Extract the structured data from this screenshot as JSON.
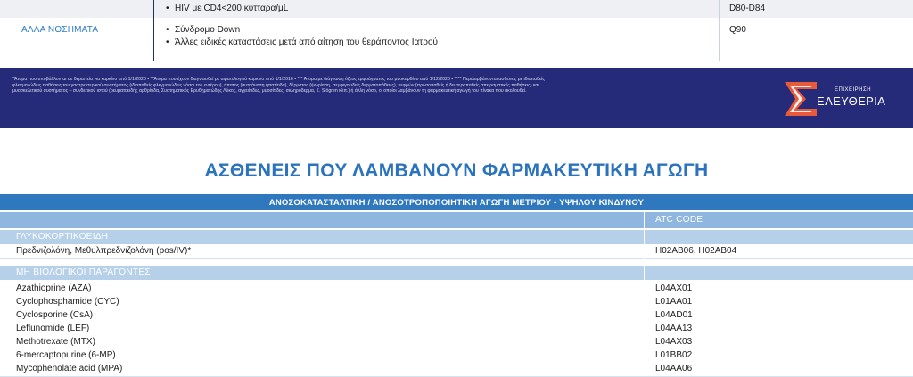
{
  "top_table": {
    "row1": {
      "bullet": "HIV με CD4<200 κύτταρα/μL",
      "code": "D80-D84"
    },
    "row2": {
      "category": "ΑΛΛΑ ΝΟΣΗΜΑΤΑ",
      "bullets": [
        "Σύνδρομο Down",
        "Άλλες ειδικές καταστάσεις μετά από αίτηση του θεράποντος Ιατρού"
      ],
      "code": "Q90"
    }
  },
  "banner": {
    "footnote": "*Άτομα που υποβάλλονται σε θεραπεία για καρκίνο από 1/1/2020 • **Άτομα που έχουν διαγνωσθεί με αιματολογικό καρκίνο από 1/1/2016 • *** Άτομα με διάγνωση όζεος εμφράγματος του μυοκαρδίου από 1/12/2020 • **** Περιλαμβάνονται ασθενείς με ιδιοπαθείς φλεγμονώδεις παθήσεις του γαστρεντερικού συστήματος (ιδιοπαθείς φλεγμονώδεις νόσοι του εντέρου), ήπατος (αυτοάνοση ηπατίτιδα), δέρματος (ψωρίαση, πεμφιγοειδείς δερματοπάθειες), νεφρών (πρωτοπαθείς ή δευτεροπαθείς σπειραματικές παθήσεις) και μυοσκελετικού συστήματος – συνδετικού ιστού (ρευματοειδής αρθρίτιδα, Συστηματικός Ερυθηματώδης Λύκος, αγγειίτιδες, μυοσίτιδες, σκληρόδερμα, Σ. Sjögren κλπ.) ή άλλη νόσο, οι οποίοι λαμβάνουν τη φαρμακευτική αγωγή του πίνακα που ακολουθεί.",
    "logo_top": "ΕΠΙΧΕΙΡΗΣΗ",
    "logo_bottom": "ΕΛΕΥΘΕΡΙΑ",
    "logo_color": "#e85a3c"
  },
  "heading": "ΑΣΘΕΝΕΙΣ ΠΟΥ ΛΑΜΒΑΝΟΥΝ ΦΑΡΜΑΚΕΥΤΙΚΗ ΑΓΩΓΗ",
  "table": {
    "title": "ΑΝΟΣΟΚΑΤΑΣΤΑΛΤΙΚΗ / ΑΝΟΣΟΤΡΟΠΟΠΟΙΗΤΙΚΗ ΑΓΩΓΗ ΜΕΤΡΙΟΥ - ΥΨΗΛΟΥ ΚΙΝΔΥΝΟΥ",
    "atc_header": "ATC CODE",
    "sections": [
      {
        "label": "ΓΛΥΚΟΚΟΡΤΙΚΟΕΙΔΗ",
        "rows": [
          {
            "name": "Πρεδνιζολόνη, Μεθυλπρεδνιζολόνη (pos/IV)*",
            "atc": "H02AB06, H02AB04"
          }
        ]
      },
      {
        "label": "ΜΗ ΒΙΟΛΟΓΙΚΟΙ ΠΑΡΑΓΟΝΤΕΣ",
        "rows": [
          {
            "name": "Azathioprine (AZA)",
            "atc": "L04AX01"
          },
          {
            "name": "Cyclophosphamide (CYC)",
            "atc": "L01AA01"
          },
          {
            "name": "Cyclosporine (CsA)",
            "atc": "L04AD01"
          },
          {
            "name": "Leflunomide (LEF)",
            "atc": "L04AA13"
          },
          {
            "name": "Methotrexate (MTX)",
            "atc": "L04AX03"
          },
          {
            "name": "6-mercaptopurine (6-MP)",
            "atc": "L01BB02"
          },
          {
            "name": "Mycophenolate acid (MPA)",
            "atc": "L04AA06"
          }
        ]
      }
    ]
  }
}
